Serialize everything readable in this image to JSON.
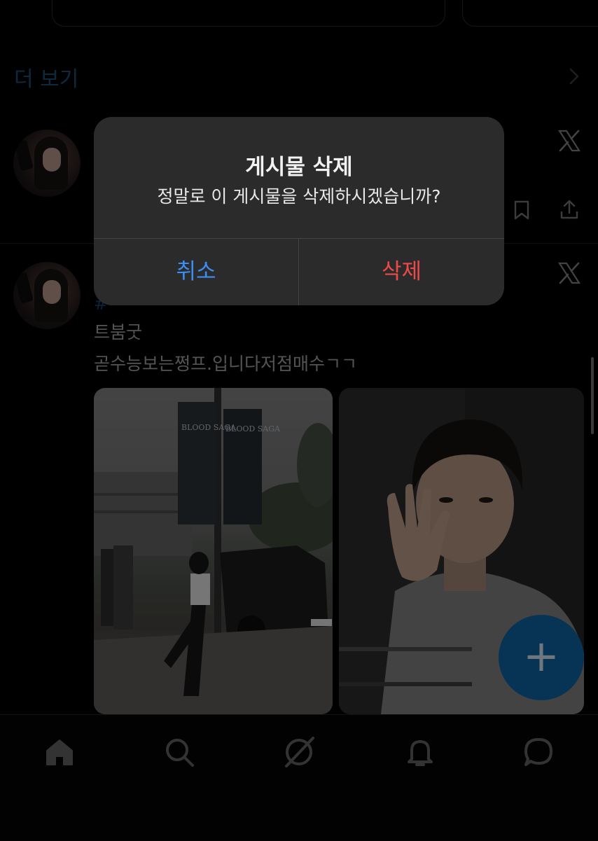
{
  "feed": {
    "more_label": "더 보기",
    "tweet2": {
      "hashtag": "#",
      "line1": "트붐굿",
      "line2": "곧수능보는쩡프.입니다저점매수ㄱㄱ"
    },
    "photo_left_text": "BLOOD SAGA"
  },
  "alert": {
    "title": "게시물 삭제",
    "message": "정말로 이 게시물을 삭제하시겠습니까?",
    "cancel_label": "취소",
    "delete_label": "삭제"
  },
  "fab": {
    "label": "+"
  },
  "tabs": [
    {
      "name": "home",
      "icon": "home-icon"
    },
    {
      "name": "search",
      "icon": "search-icon"
    },
    {
      "name": "grok",
      "icon": "grok-icon"
    },
    {
      "name": "notifications",
      "icon": "bell-icon"
    },
    {
      "name": "messages",
      "icon": "chat-icon"
    }
  ],
  "colors": {
    "accent_blue": "#3d8ef2",
    "destructive_red": "#ef4a4a",
    "alert_bg": "#2b2b2b",
    "fab": "#0d5f9c"
  }
}
